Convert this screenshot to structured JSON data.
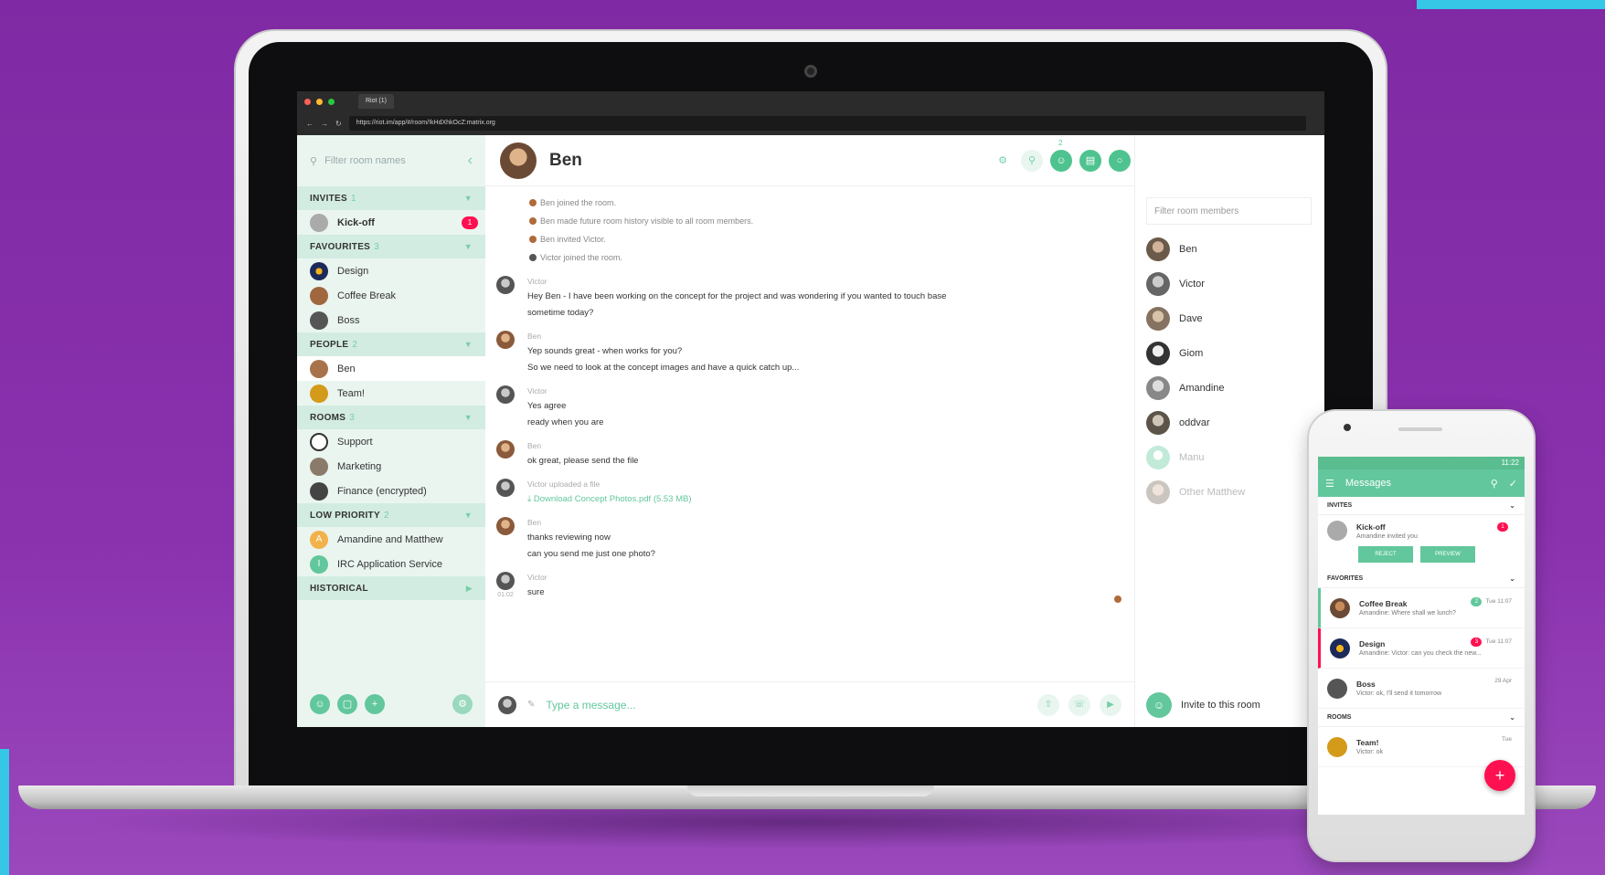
{
  "browser": {
    "tab_title": "Riot (1)",
    "url": "https://riot.im/app/#/room/!kHdXhkOcZ:matrix.org"
  },
  "left": {
    "search_placeholder": "Filter room names",
    "sections": {
      "invites": {
        "label": "INVITES",
        "count": "1"
      },
      "favourites": {
        "label": "FAVOURITES",
        "count": "3"
      },
      "people": {
        "label": "PEOPLE",
        "count": "2"
      },
      "rooms": {
        "label": "ROOMS",
        "count": "3"
      },
      "low_priority": {
        "label": "LOW PRIORITY",
        "count": "2"
      },
      "historical": {
        "label": "HISTORICAL"
      }
    },
    "invites": [
      {
        "name": "Kick-off",
        "badge": "1"
      }
    ],
    "favourites": [
      {
        "name": "Design"
      },
      {
        "name": "Coffee Break"
      },
      {
        "name": "Boss"
      }
    ],
    "people": [
      {
        "name": "Ben"
      },
      {
        "name": "Team!"
      }
    ],
    "rooms": [
      {
        "name": "Support"
      },
      {
        "name": "Marketing"
      },
      {
        "name": "Finance (encrypted)"
      }
    ],
    "low_priority": [
      {
        "name": "Amandine and Matthew",
        "initial": "A"
      },
      {
        "name": "IRC Application Service",
        "initial": "I"
      }
    ]
  },
  "room": {
    "name": "Ben",
    "events": [
      "Ben joined the room.",
      "Ben made future room history visible to all room members.",
      "Ben invited Victor.",
      "Victor joined the room."
    ],
    "messages": [
      {
        "sender": "Victor",
        "lines": [
          "Hey Ben - I have been working on the concept for the project and was wondering if you wanted to touch base",
          "sometime today?"
        ]
      },
      {
        "sender": "Ben",
        "lines": [
          "Yep sounds great - when works for you?",
          "So we need to look at the concept images and have a quick catch up..."
        ]
      },
      {
        "sender": "Victor",
        "lines": [
          "Yes agree",
          "ready when you are"
        ]
      },
      {
        "sender": "Ben",
        "lines": [
          "ok great, please send the file"
        ]
      },
      {
        "sender": "Victor uploaded a file",
        "lines": [
          "Download Concept Photos.pdf (5.53 MB)"
        ]
      },
      {
        "sender": "Ben",
        "lines": [
          "thanks reviewing now",
          "can you send me just one photo?"
        ]
      },
      {
        "sender": "Victor",
        "time": "01:02",
        "lines": [
          "sure"
        ]
      }
    ],
    "composer_placeholder": "Type a message...",
    "member_count": "2"
  },
  "members": {
    "filter_placeholder": "Filter room members",
    "list": [
      {
        "name": "Ben",
        "online": true
      },
      {
        "name": "Victor",
        "online": true
      },
      {
        "name": "Dave",
        "online": true
      },
      {
        "name": "Giom",
        "online": true
      },
      {
        "name": "Amandine",
        "online": true
      },
      {
        "name": "oddvar",
        "online": true
      },
      {
        "name": "Manu",
        "online": false
      },
      {
        "name": "Other Matthew",
        "online": false
      }
    ],
    "invite_label": "Invite to this room"
  },
  "phone": {
    "status_time": "11:22",
    "title": "Messages",
    "sections": {
      "invites": "INVITES",
      "favorites": "FAVORITES",
      "rooms": "ROOMS"
    },
    "invite": {
      "name": "Kick-off",
      "sub": "Amandine invited you",
      "badge": "1",
      "reject": "REJECT",
      "preview": "PREVIEW"
    },
    "favorites": [
      {
        "name": "Coffee Break",
        "sub": "Amandine: Where shall we lunch?",
        "time": "Tue 11:07",
        "badge": "2",
        "badge_color": "green"
      },
      {
        "name": "Design",
        "sub": "Amandine: Victor: can you check the new...",
        "time": "Tue 11:07",
        "badge": "3",
        "badge_color": "red"
      },
      {
        "name": "Boss",
        "sub": "Victor: ok, I'll send it tomorrow",
        "time": "29 Apr",
        "badge": "",
        "badge_color": ""
      }
    ],
    "rooms": [
      {
        "name": "Team!",
        "sub": "Victor: ok",
        "time": "Tue"
      }
    ]
  },
  "colors": {
    "accent": "#62c79c",
    "alert": "#ff1050",
    "background": "#8a31ae"
  }
}
